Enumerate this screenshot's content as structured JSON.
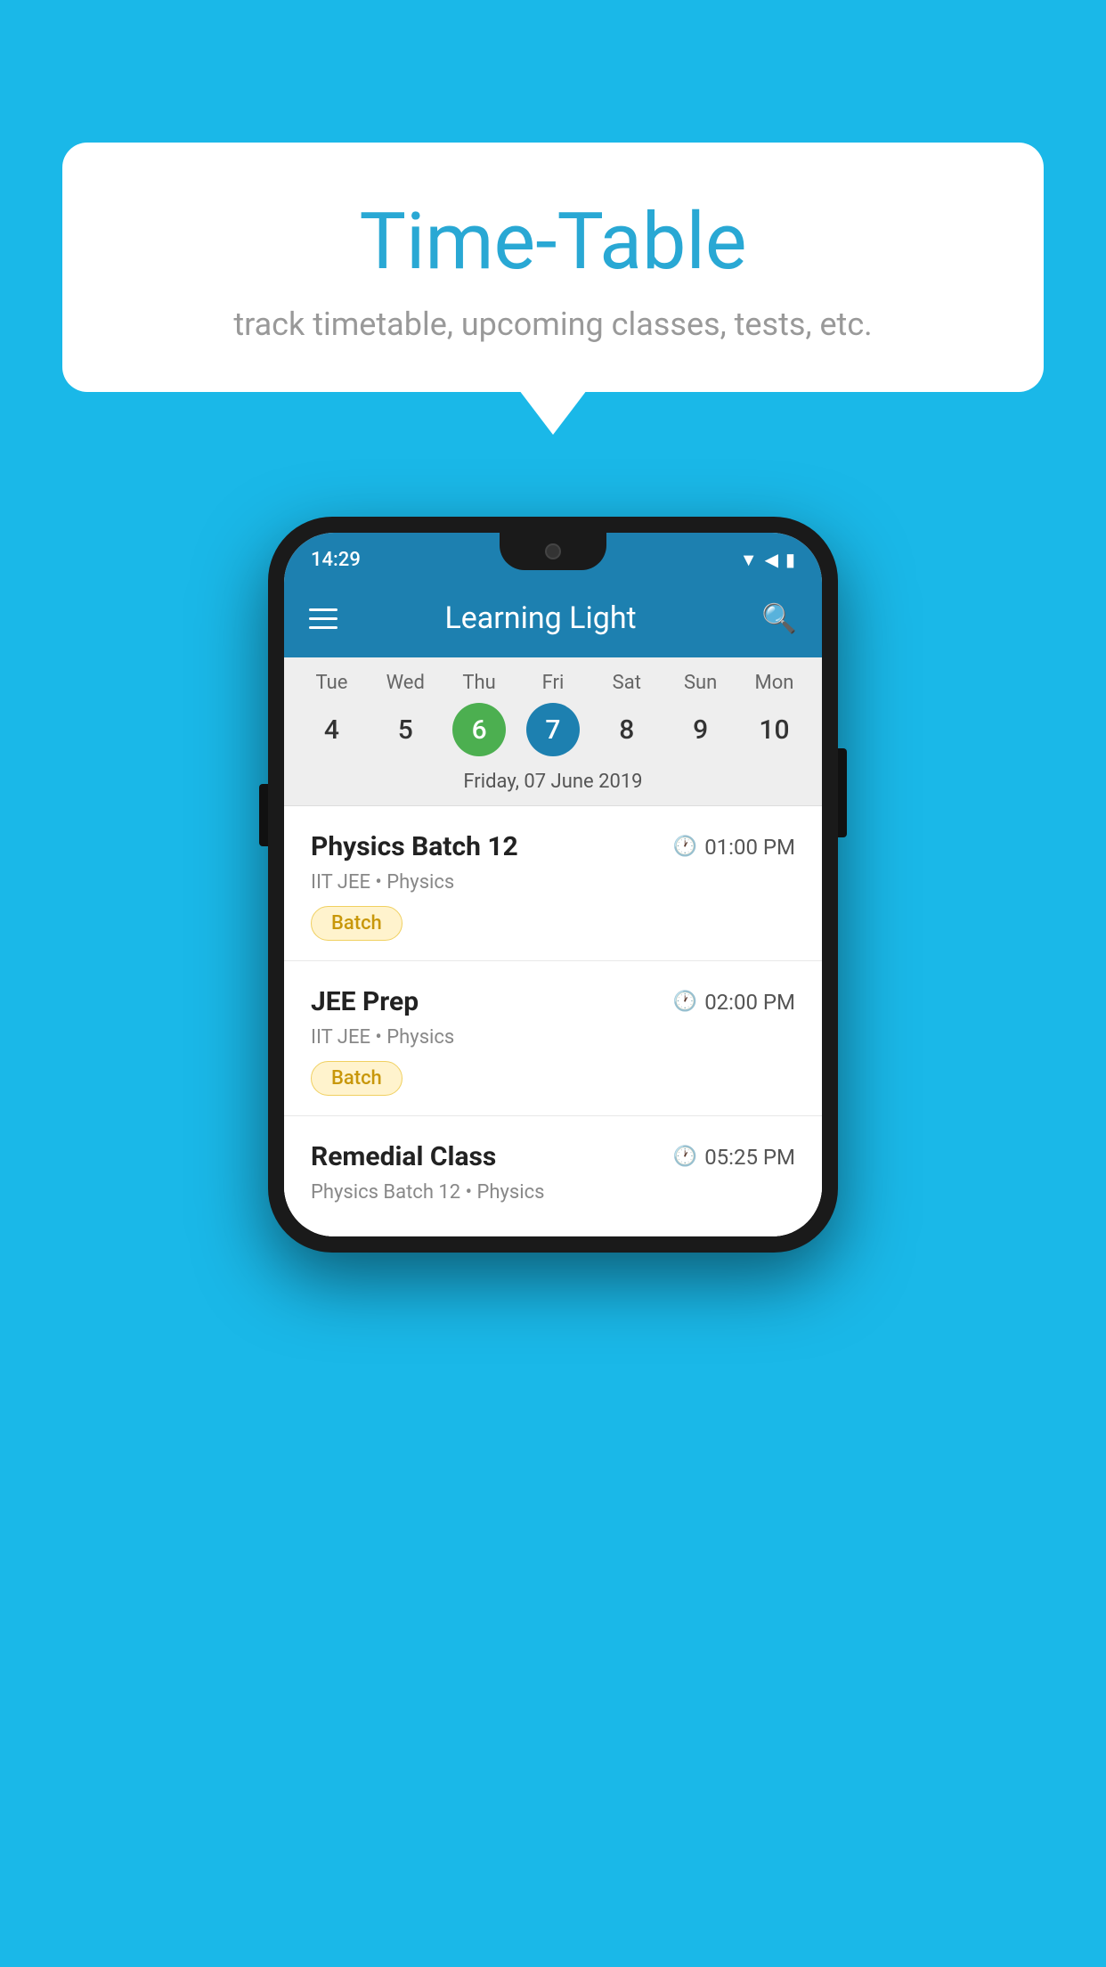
{
  "background_color": "#1ab8e8",
  "bubble": {
    "title": "Time-Table",
    "subtitle": "track timetable, upcoming classes, tests, etc."
  },
  "phone": {
    "status_bar": {
      "time": "14:29"
    },
    "app_bar": {
      "title": "Learning Light"
    },
    "calendar": {
      "days": [
        {
          "name": "Tue",
          "num": "4",
          "state": "normal"
        },
        {
          "name": "Wed",
          "num": "5",
          "state": "normal"
        },
        {
          "name": "Thu",
          "num": "6",
          "state": "today"
        },
        {
          "name": "Fri",
          "num": "7",
          "state": "selected"
        },
        {
          "name": "Sat",
          "num": "8",
          "state": "normal"
        },
        {
          "name": "Sun",
          "num": "9",
          "state": "normal"
        },
        {
          "name": "Mon",
          "num": "10",
          "state": "normal"
        }
      ],
      "selected_date_label": "Friday, 07 June 2019"
    },
    "schedule": [
      {
        "title": "Physics Batch 12",
        "time": "01:00 PM",
        "subtitle": "IIT JEE • Physics",
        "tag": "Batch"
      },
      {
        "title": "JEE Prep",
        "time": "02:00 PM",
        "subtitle": "IIT JEE • Physics",
        "tag": "Batch"
      },
      {
        "title": "Remedial Class",
        "time": "05:25 PM",
        "subtitle": "Physics Batch 12 • Physics",
        "tag": null
      }
    ]
  }
}
